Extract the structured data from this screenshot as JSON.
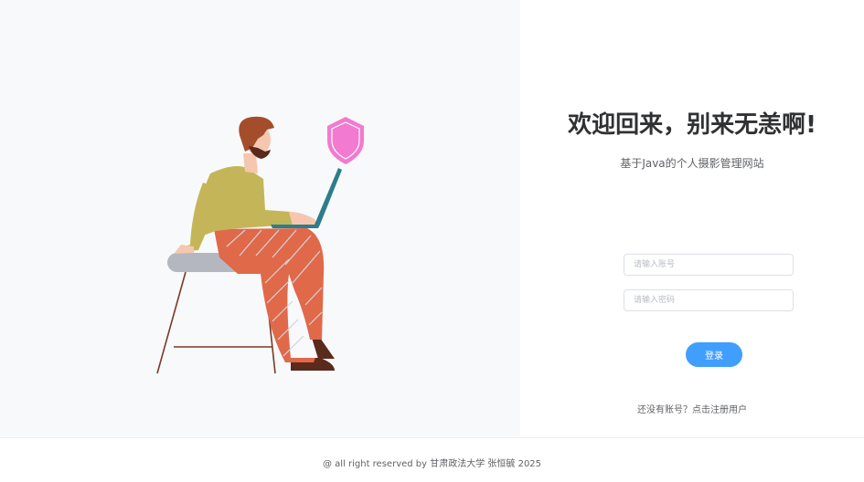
{
  "welcome": {
    "title": "欢迎回来，别来无恙啊!",
    "subtitle": "基于Java的个人摄影管理网站"
  },
  "form": {
    "account_placeholder": "请输入账号",
    "password_placeholder": "请输入密码",
    "login_label": "登录",
    "register_text": "还没有账号？点击注册用户"
  },
  "footer": {
    "text": "@ all right reserved by 甘肃政法大学 张恒毓 2025"
  },
  "colors": {
    "primary": "#409eff",
    "shield": "#f27ad0",
    "shirt": "#c4b658",
    "pants": "#e0694a",
    "hair": "#a34d2a",
    "laptop": "#2d7d8a",
    "seat": "#b4b7bf"
  },
  "illustration": {
    "icons": [
      "shield-icon"
    ]
  }
}
